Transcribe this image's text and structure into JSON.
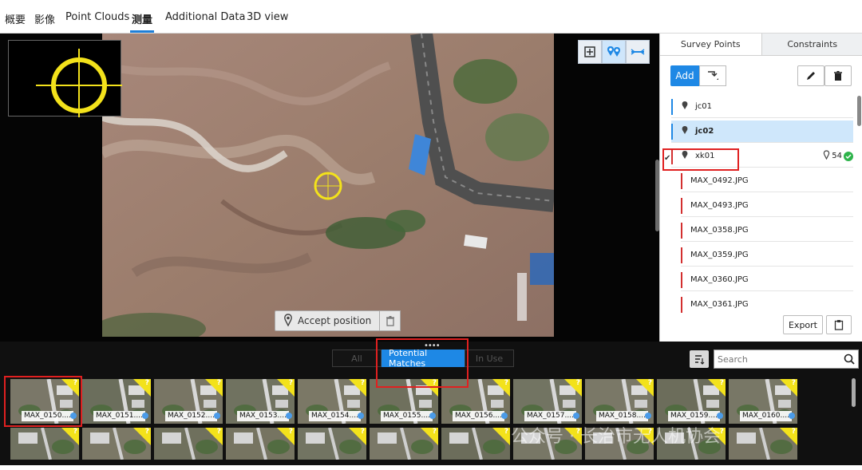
{
  "top_tabs": [
    {
      "label": "概要"
    },
    {
      "label": "影像"
    },
    {
      "label": "Point Clouds"
    },
    {
      "label": "测量"
    },
    {
      "label": "Additional Data"
    },
    {
      "label": "3D view"
    }
  ],
  "active_top_tab": "测量",
  "viewer": {
    "accept_label": "Accept position",
    "toolbar_icons": [
      "zoom-extent-icon",
      "multi-pin-icon",
      "measure-icon"
    ]
  },
  "right_panel": {
    "tabs": [
      {
        "label": "Survey Points"
      },
      {
        "label": "Constraints"
      }
    ],
    "add_label": "Add",
    "points": [
      {
        "name": "jc01",
        "bar_color": "#1e88e5",
        "selected": false
      },
      {
        "name": "jc02",
        "bar_color": "#1e88e5",
        "selected": true
      },
      {
        "name": "xk01",
        "bar_color": "#d32f2f",
        "selected": false,
        "count": "54",
        "checked": true
      }
    ],
    "images": [
      "MAX_0492.JPG",
      "MAX_0493.JPG",
      "MAX_0358.JPG",
      "MAX_0359.JPG",
      "MAX_0360.JPG",
      "MAX_0361.JPG"
    ],
    "export_label": "Export"
  },
  "bottom": {
    "filters": [
      {
        "label": "All"
      },
      {
        "label": "Potential Matches"
      },
      {
        "label": "In Use"
      }
    ],
    "active_filter": "Potential Matches",
    "search_placeholder": "Search",
    "thumbnails": [
      "MAX_0150....",
      "MAX_0151....",
      "MAX_0152....",
      "MAX_0153....",
      "MAX_0154....",
      "MAX_0155....",
      "MAX_0156....",
      "MAX_0157....",
      "MAX_0158....",
      "MAX_0159....",
      "MAX_0160...."
    ]
  },
  "watermark": "公众号 · 长治市无人机协会",
  "colors": {
    "accent": "#1e88e5",
    "highlight_red": "#e02020",
    "target_yellow": "#f3e21b"
  }
}
